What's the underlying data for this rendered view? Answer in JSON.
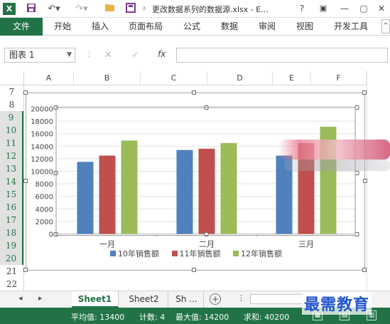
{
  "titlebar": {
    "app_icon": "X",
    "save_icon": "save-icon",
    "undo_icon": "undo-icon",
    "redo_icon": "redo-icon",
    "open_icon": "folder-icon",
    "title": "更改数据系列的数据源.xlsx - E...",
    "help": "?",
    "min": "—",
    "restore": "▢",
    "close": "✕"
  },
  "ribbon": {
    "file": "文件",
    "tabs": [
      "开始",
      "插入",
      "页面布局",
      "公式",
      "数据",
      "审阅",
      "视图",
      "开发工具"
    ],
    "collapse": "^"
  },
  "formula_bar": {
    "name_box": "图表 1",
    "cancel": "✕",
    "enter": "✓",
    "fx": "fx",
    "value": ""
  },
  "columns": [
    "A",
    "B",
    "C",
    "D",
    "E",
    "F"
  ],
  "rows": [
    "7",
    "8",
    "9",
    "10",
    "11",
    "12",
    "13",
    "14",
    "15",
    "16",
    "17",
    "18",
    "19",
    "20",
    "21",
    "22"
  ],
  "chart_data": {
    "type": "bar",
    "categories": [
      "一月",
      "二月",
      "三月"
    ],
    "series": [
      {
        "name": "10年销售额",
        "values": [
          11500,
          13400,
          12500
        ],
        "color": "#4f81bd"
      },
      {
        "name": "11年销售额",
        "values": [
          12500,
          13600,
          14500
        ],
        "color": "#c0504d"
      },
      {
        "name": "12年销售额",
        "values": [
          14900,
          14500,
          17100
        ],
        "color": "#9bbb59"
      }
    ],
    "ylim": [
      0,
      20000
    ],
    "yticks": [
      "0",
      "2000",
      "4000",
      "6000",
      "8000",
      "10000",
      "12000",
      "14000",
      "16000",
      "18000",
      "20000"
    ],
    "grid": true,
    "legend": "bottom"
  },
  "sheets": {
    "tabs": [
      "Sheet1",
      "Sheet2",
      "Sh ..."
    ],
    "active": 0,
    "add": "+"
  },
  "status": {
    "average": "平均值: 13400",
    "count": "计数: 4",
    "max": "最大值: 14200",
    "sum": "求和: 40200"
  },
  "watermark": "最需教育"
}
